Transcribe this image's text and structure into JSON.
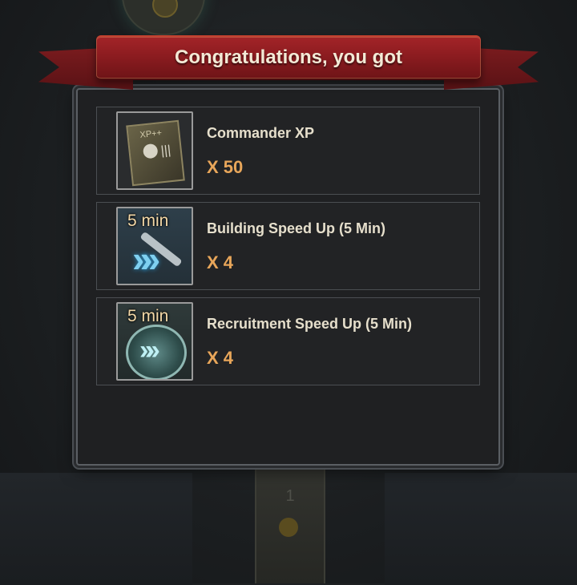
{
  "dialog": {
    "title": "Congratulations, you got"
  },
  "rewards": [
    {
      "name": "Commander XP",
      "quantity": "X 50",
      "icon": "xp-book-icon",
      "badge": "",
      "icon_text": "XP++"
    },
    {
      "name": "Building Speed Up (5 Min)",
      "quantity": "X 4",
      "icon": "building-speedup-icon",
      "badge": "5 min"
    },
    {
      "name": "Recruitment Speed Up (5 Min)",
      "quantity": "X 4",
      "icon": "recruitment-speedup-icon",
      "badge": "5 min"
    }
  ],
  "background": {
    "banner_number": "1"
  },
  "colors": {
    "ribbon": "#8c1c20",
    "quantity": "#e8a65a",
    "panel": "#1f2022"
  }
}
